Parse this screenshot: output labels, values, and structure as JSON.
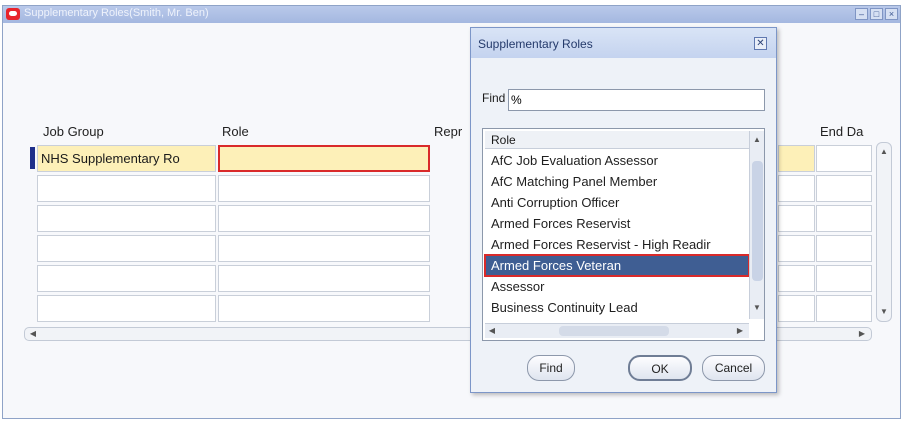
{
  "main_window": {
    "title": "Supplementary Roles(Smith, Mr. Ben)",
    "controls": [
      "–",
      "□",
      "×"
    ]
  },
  "columns": {
    "job_group": "Job Group",
    "role": "Role",
    "repr": "Repr",
    "end_date": "End Da"
  },
  "rows": [
    {
      "job_group": "NHS Supplementary Ro",
      "role": ""
    },
    {
      "job_group": "",
      "role": ""
    },
    {
      "job_group": "",
      "role": ""
    },
    {
      "job_group": "",
      "role": ""
    },
    {
      "job_group": "",
      "role": ""
    },
    {
      "job_group": "",
      "role": ""
    }
  ],
  "icons": {
    "up": "▲",
    "down": "▼",
    "left": "◀",
    "right": "▶",
    "close": "✕"
  },
  "dialog": {
    "title": "Supplementary Roles",
    "find_label": "Find",
    "find_value": "%",
    "list_header": "Role",
    "items": [
      "AfC Job Evaluation Assessor",
      "AfC Matching Panel Member",
      "Anti Corruption Officer",
      "Armed Forces Reservist",
      "Armed Forces Reservist - High Readir",
      "Armed Forces Veteran",
      "Assessor",
      "Business Continuity Lead"
    ],
    "selected_item": "Armed Forces Veteran",
    "buttons": {
      "find": "Find",
      "ok": "OK",
      "cancel": "Cancel"
    }
  }
}
